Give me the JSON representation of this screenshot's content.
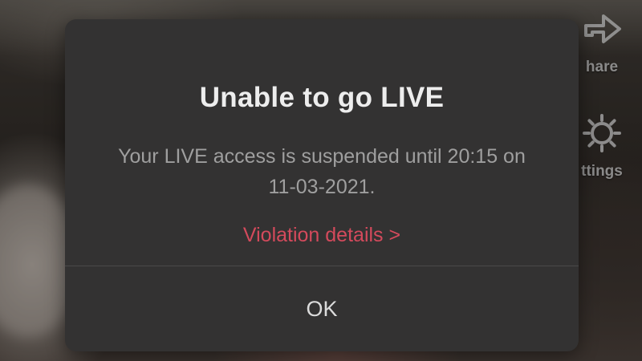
{
  "background": {
    "share_label": "hare",
    "settings_label": "ttings",
    "icons": [
      "share-arrow-icon",
      "gear-icon"
    ]
  },
  "dialog": {
    "title": "Unable to go LIVE",
    "message": "Your LIVE access is suspended until 20:15 on 11-03-2021.",
    "violation_link": "Violation details >",
    "ok_label": "OK"
  },
  "colors": {
    "dialog_bg": "#333232",
    "title": "#ededed",
    "message": "#9f9f9f",
    "link": "#d44a5c",
    "divider": "#4a4949"
  }
}
